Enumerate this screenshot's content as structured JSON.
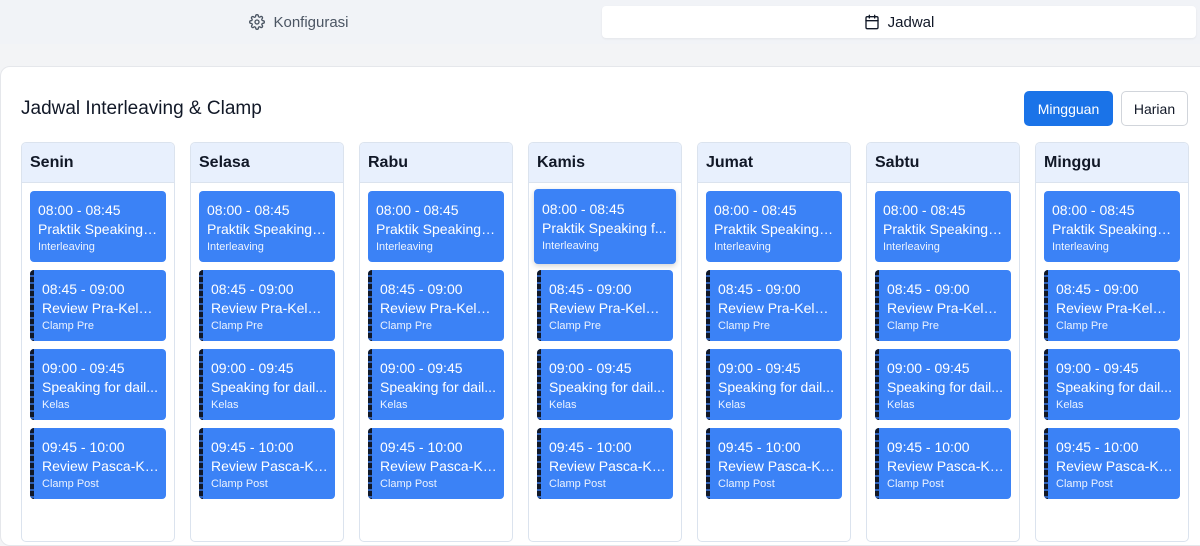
{
  "tabs": [
    {
      "label": "Konfigurasi",
      "icon": "gear-icon",
      "active": false
    },
    {
      "label": "Jadwal",
      "icon": "calendar-icon",
      "active": true
    }
  ],
  "page_title": "Jadwal Interleaving & Clamp",
  "view_buttons": {
    "weekly": "Mingguan",
    "daily": "Harian"
  },
  "days": [
    {
      "name": "Senin",
      "slots": [
        {
          "time": "08:00 - 08:45",
          "subject": "Praktik Speaking f...",
          "type": "Interleaving"
        },
        {
          "time": "08:45 - 09:00",
          "subject": "Review Pra-Kelas...",
          "type": "Clamp Pre"
        },
        {
          "time": "09:00 - 09:45",
          "subject": "Speaking for dail...",
          "type": "Kelas"
        },
        {
          "time": "09:45 - 10:00",
          "subject": "Review Pasca-Kel...",
          "type": "Clamp Post"
        }
      ]
    },
    {
      "name": "Selasa",
      "slots": [
        {
          "time": "08:00 - 08:45",
          "subject": "Praktik Speaking f...",
          "type": "Interleaving"
        },
        {
          "time": "08:45 - 09:00",
          "subject": "Review Pra-Kelas...",
          "type": "Clamp Pre"
        },
        {
          "time": "09:00 - 09:45",
          "subject": "Speaking for dail...",
          "type": "Kelas"
        },
        {
          "time": "09:45 - 10:00",
          "subject": "Review Pasca-Kel...",
          "type": "Clamp Post"
        }
      ]
    },
    {
      "name": "Rabu",
      "slots": [
        {
          "time": "08:00 - 08:45",
          "subject": "Praktik Speaking f...",
          "type": "Interleaving"
        },
        {
          "time": "08:45 - 09:00",
          "subject": "Review Pra-Kelas...",
          "type": "Clamp Pre"
        },
        {
          "time": "09:00 - 09:45",
          "subject": "Speaking for dail...",
          "type": "Kelas"
        },
        {
          "time": "09:45 - 10:00",
          "subject": "Review Pasca-Kel...",
          "type": "Clamp Post"
        }
      ]
    },
    {
      "name": "Kamis",
      "slots": [
        {
          "time": "08:00 - 08:45",
          "subject": "Praktik Speaking f...",
          "type": "Interleaving"
        },
        {
          "time": "08:45 - 09:00",
          "subject": "Review Pra-Kelas...",
          "type": "Clamp Pre"
        },
        {
          "time": "09:00 - 09:45",
          "subject": "Speaking for dail...",
          "type": "Kelas"
        },
        {
          "time": "09:45 - 10:00",
          "subject": "Review Pasca-Kel...",
          "type": "Clamp Post"
        }
      ]
    },
    {
      "name": "Jumat",
      "slots": [
        {
          "time": "08:00 - 08:45",
          "subject": "Praktik Speaking f...",
          "type": "Interleaving"
        },
        {
          "time": "08:45 - 09:00",
          "subject": "Review Pra-Kelas...",
          "type": "Clamp Pre"
        },
        {
          "time": "09:00 - 09:45",
          "subject": "Speaking for dail...",
          "type": "Kelas"
        },
        {
          "time": "09:45 - 10:00",
          "subject": "Review Pasca-Kel...",
          "type": "Clamp Post"
        }
      ]
    },
    {
      "name": "Sabtu",
      "slots": [
        {
          "time": "08:00 - 08:45",
          "subject": "Praktik Speaking f...",
          "type": "Interleaving"
        },
        {
          "time": "08:45 - 09:00",
          "subject": "Review Pra-Kelas...",
          "type": "Clamp Pre"
        },
        {
          "time": "09:00 - 09:45",
          "subject": "Speaking for dail...",
          "type": "Kelas"
        },
        {
          "time": "09:45 - 10:00",
          "subject": "Review Pasca-Kel...",
          "type": "Clamp Post"
        }
      ]
    },
    {
      "name": "Minggu",
      "slots": [
        {
          "time": "08:00 - 08:45",
          "subject": "Praktik Speaking f...",
          "type": "Interleaving"
        },
        {
          "time": "08:45 - 09:00",
          "subject": "Review Pra-Kelas...",
          "type": "Clamp Pre"
        },
        {
          "time": "09:00 - 09:45",
          "subject": "Speaking for dail...",
          "type": "Kelas"
        },
        {
          "time": "09:45 - 10:00",
          "subject": "Review Pasca-Kel...",
          "type": "Clamp Post"
        }
      ]
    }
  ],
  "colors": {
    "accent": "#1a73e8",
    "slot": "#3b82f6",
    "column_header": "#e8f0fd"
  }
}
